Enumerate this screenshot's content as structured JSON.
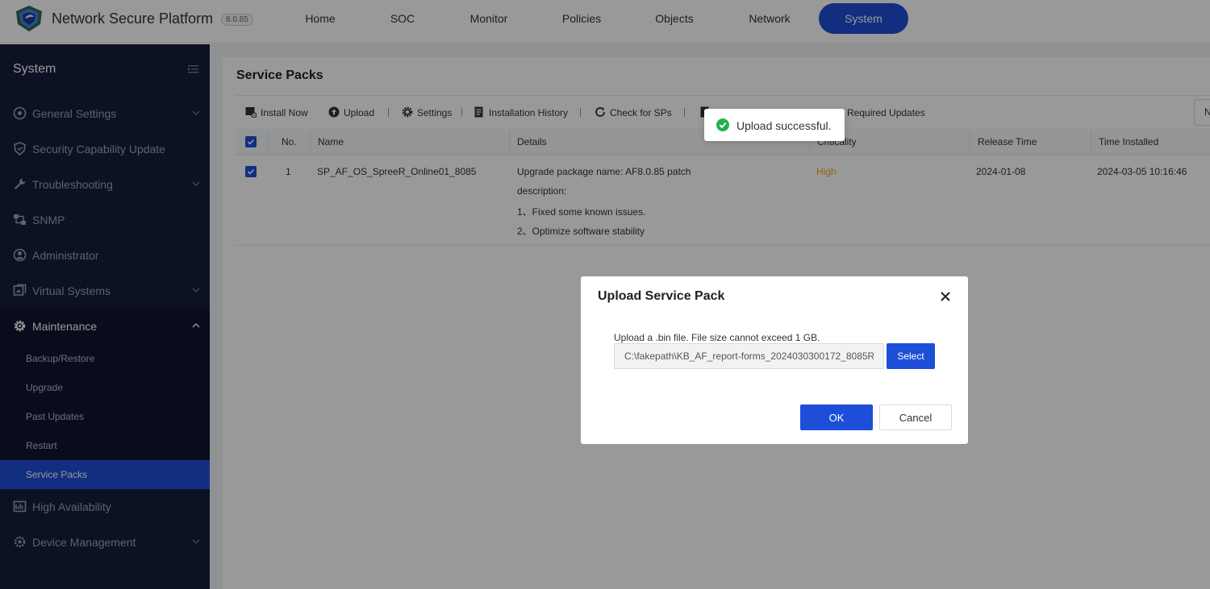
{
  "header": {
    "brand": "Network Secure Platform",
    "version": "8.0.85",
    "nav": [
      {
        "label": "Home"
      },
      {
        "label": "SOC"
      },
      {
        "label": "Monitor"
      },
      {
        "label": "Policies"
      },
      {
        "label": "Objects"
      },
      {
        "label": "Network"
      },
      {
        "label": "System"
      }
    ],
    "active_nav": "System"
  },
  "sidebar": {
    "title": "System",
    "items": [
      {
        "label": "General Settings",
        "icon": "gear-circle-icon",
        "expandable": true
      },
      {
        "label": "Security Capability Update",
        "icon": "shield-icon",
        "expandable": false
      },
      {
        "label": "Troubleshooting",
        "icon": "wrench-icon",
        "expandable": true
      },
      {
        "label": "SNMP",
        "icon": "snmp-icon",
        "expandable": false
      },
      {
        "label": "Administrator",
        "icon": "user-icon",
        "expandable": false
      },
      {
        "label": "Virtual Systems",
        "icon": "layers-icon",
        "expandable": true
      },
      {
        "label": "Maintenance",
        "icon": "gear-icon",
        "expandable": true,
        "open": true
      },
      {
        "label": "High Availability",
        "icon": "ha-icon",
        "expandable": false
      },
      {
        "label": "Device Management",
        "icon": "cog-icon",
        "expandable": true
      }
    ],
    "sub_items": [
      {
        "label": "Backup/Restore"
      },
      {
        "label": "Upgrade"
      },
      {
        "label": "Past Updates"
      },
      {
        "label": "Restart"
      },
      {
        "label": "Service Packs",
        "active": true
      }
    ]
  },
  "page": {
    "title": "Service Packs",
    "toolbar": {
      "install_now": "Install Now",
      "upload": "Upload",
      "settings": "Settings",
      "installation_history": "Installation History",
      "check_for_sps": "Check for SPs",
      "required_updates": "Required Updates",
      "right_box": "N"
    },
    "table": {
      "columns": [
        "No.",
        "Name",
        "Details",
        "Criticality",
        "Release Time",
        "Time Installed"
      ],
      "rows": [
        {
          "no": "1",
          "name": "SP_AF_OS_SpreeR_Online01_8085",
          "details": [
            "Upgrade package name: AF8.0.85 patch",
            "description:",
            "1、Fixed some known issues.",
            "2、Optimize software stability"
          ],
          "criticality": "High",
          "release_time": "2024-01-08",
          "time_installed": "2024-03-05 10:16:46"
        }
      ]
    }
  },
  "modal": {
    "title": "Upload Service Pack",
    "hint": "Upload a .bin file. File size cannot exceed 1 GB.",
    "file_value": "C:\\fakepath\\KB_AF_report-forms_2024030300172_8085R",
    "select_label": "Select",
    "ok_label": "OK",
    "cancel_label": "Cancel"
  },
  "toast": {
    "message": "Upload successful."
  },
  "colors": {
    "accent": "#1d4ed8",
    "sidebar_bg": "#141d3c",
    "criticality_high": "#f5a623",
    "success": "#22b14c"
  }
}
